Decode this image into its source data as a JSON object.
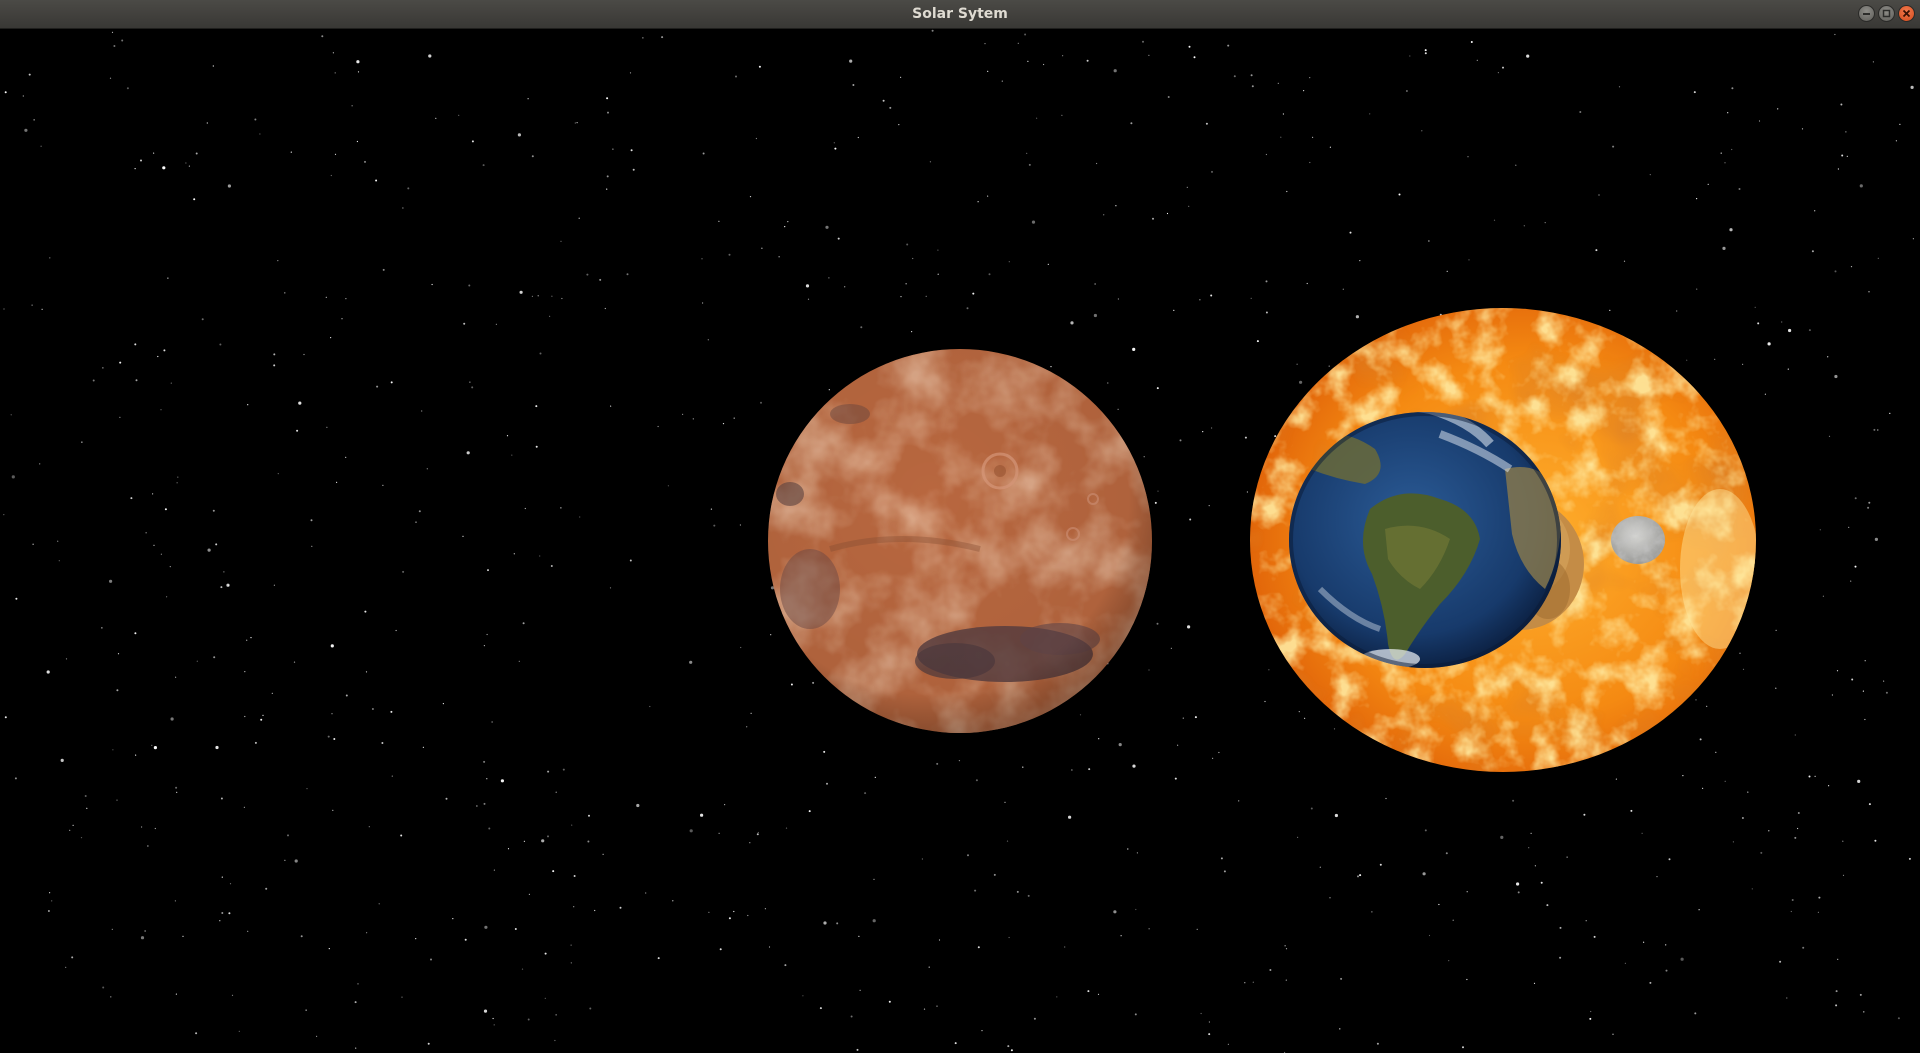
{
  "window": {
    "title": "Solar Sytem",
    "buttons": {
      "minimize": "minimize-icon",
      "maximize": "maximize-icon",
      "close": "close-icon"
    }
  },
  "scene": {
    "background_color": "#000000",
    "star_color": "#ffffff",
    "bodies": [
      {
        "name": "mars",
        "color": "#b5653f"
      },
      {
        "name": "sun",
        "color": "#f07a10"
      },
      {
        "name": "venus",
        "color": "#c8934a"
      },
      {
        "name": "earth",
        "color": "#1c3f74"
      },
      {
        "name": "moon",
        "color": "#b9b9b7"
      }
    ]
  }
}
